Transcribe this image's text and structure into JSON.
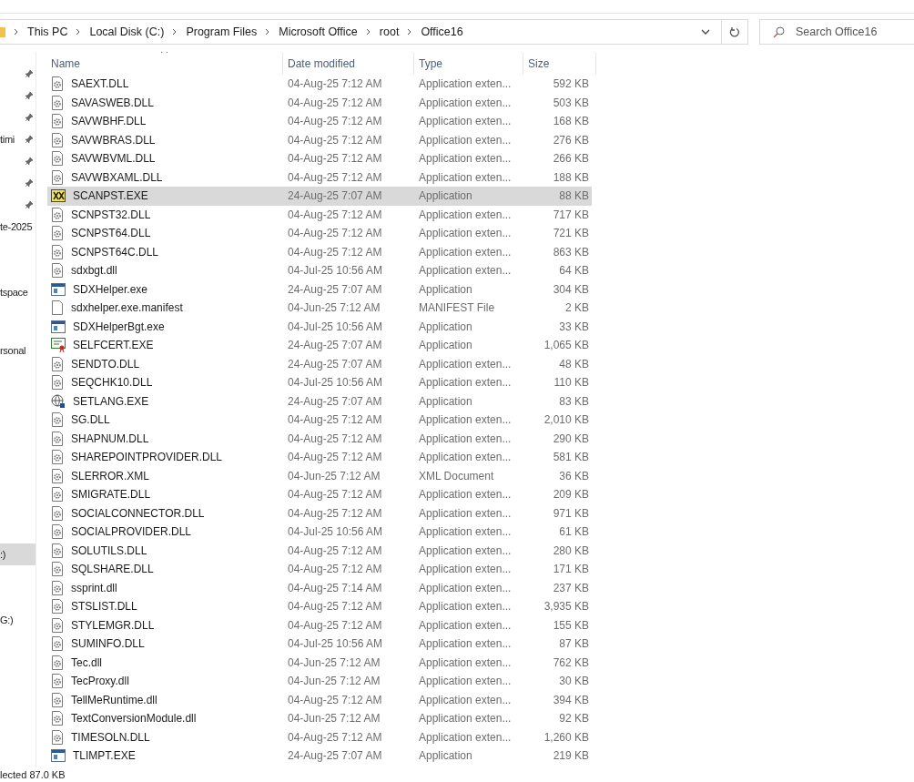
{
  "breadcrumb": [
    "This PC",
    "Local Disk (C:)",
    "Program Files",
    "Microsoft Office",
    "root",
    "Office16"
  ],
  "search": {
    "placeholder": "Search Office16"
  },
  "sidebar": {
    "items": [
      {
        "pinned": true
      },
      {
        "pinned": true
      },
      {
        "pinned": true
      },
      {
        "label": "timi",
        "pinned": true
      },
      {
        "pinned": true
      },
      {
        "pinned": true
      },
      {
        "pinned": true
      },
      {
        "label": "te-2025",
        "pinned": false,
        "selected": false
      },
      {
        "label": "tspace",
        "pinned": false,
        "selected": false
      },
      {
        "label": "rsonal",
        "pinned": false,
        "selected": false
      },
      {
        "label": ":)",
        "pinned": false,
        "selected": true
      },
      {
        "label": "G:)",
        "pinned": false,
        "selected": false
      }
    ]
  },
  "table": {
    "columns": [
      "Name",
      "Date modified",
      "Type",
      "Size"
    ],
    "rows": [
      {
        "kind": "dll",
        "name": "SAEXT.DLL",
        "date": "04-Aug-25 7:12 AM",
        "type": "Application exten...",
        "size": "592 KB",
        "selected": false
      },
      {
        "kind": "dll",
        "name": "SAVASWEB.DLL",
        "date": "04-Aug-25 7:12 AM",
        "type": "Application exten...",
        "size": "503 KB",
        "selected": false
      },
      {
        "kind": "dll",
        "name": "SAVWBHF.DLL",
        "date": "04-Aug-25 7:12 AM",
        "type": "Application exten...",
        "size": "168 KB",
        "selected": false
      },
      {
        "kind": "dll",
        "name": "SAVWBRAS.DLL",
        "date": "04-Aug-25 7:12 AM",
        "type": "Application exten...",
        "size": "276 KB",
        "selected": false
      },
      {
        "kind": "dll",
        "name": "SAVWBVML.DLL",
        "date": "04-Aug-25 7:12 AM",
        "type": "Application exten...",
        "size": "266 KB",
        "selected": false
      },
      {
        "kind": "dll",
        "name": "SAVWBXAML.DLL",
        "date": "04-Aug-25 7:12 AM",
        "type": "Application exten...",
        "size": "188 KB",
        "selected": false
      },
      {
        "kind": "repair",
        "name": "SCANPST.EXE",
        "date": "24-Aug-25 7:07 AM",
        "type": "Application",
        "size": "88 KB",
        "selected": true
      },
      {
        "kind": "dll",
        "name": "SCNPST32.DLL",
        "date": "04-Aug-25 7:12 AM",
        "type": "Application exten...",
        "size": "717 KB",
        "selected": false
      },
      {
        "kind": "dll",
        "name": "SCNPST64.DLL",
        "date": "04-Aug-25 7:12 AM",
        "type": "Application exten...",
        "size": "721 KB",
        "selected": false
      },
      {
        "kind": "dll",
        "name": "SCNPST64C.DLL",
        "date": "04-Aug-25 7:12 AM",
        "type": "Application exten...",
        "size": "863 KB",
        "selected": false
      },
      {
        "kind": "dll",
        "name": "sdxbgt.dll",
        "date": "04-Jul-25 10:56 AM",
        "type": "Application exten...",
        "size": "64 KB",
        "selected": false
      },
      {
        "kind": "app",
        "name": "SDXHelper.exe",
        "date": "24-Aug-25 7:07 AM",
        "type": "Application",
        "size": "304 KB",
        "selected": false
      },
      {
        "kind": "file",
        "name": "sdxhelper.exe.manifest",
        "date": "04-Jun-25 7:12 AM",
        "type": "MANIFEST File",
        "size": "2 KB",
        "selected": false
      },
      {
        "kind": "app",
        "name": "SDXHelperBgt.exe",
        "date": "04-Jul-25 10:56 AM",
        "type": "Application",
        "size": "33 KB",
        "selected": false
      },
      {
        "kind": "cert",
        "name": "SELFCERT.EXE",
        "date": "24-Aug-25 7:07 AM",
        "type": "Application",
        "size": "1,065 KB",
        "selected": false
      },
      {
        "kind": "dll",
        "name": "SENDTO.DLL",
        "date": "24-Aug-25 7:07 AM",
        "type": "Application exten...",
        "size": "48 KB",
        "selected": false
      },
      {
        "kind": "dll",
        "name": "SEQCHK10.DLL",
        "date": "04-Jul-25 10:56 AM",
        "type": "Application exten...",
        "size": "110 KB",
        "selected": false
      },
      {
        "kind": "globe",
        "name": "SETLANG.EXE",
        "date": "24-Aug-25 7:07 AM",
        "type": "Application",
        "size": "83 KB",
        "selected": false
      },
      {
        "kind": "dll",
        "name": "SG.DLL",
        "date": "04-Aug-25 7:12 AM",
        "type": "Application exten...",
        "size": "2,010 KB",
        "selected": false
      },
      {
        "kind": "dll",
        "name": "SHAPNUM.DLL",
        "date": "04-Aug-25 7:12 AM",
        "type": "Application exten...",
        "size": "290 KB",
        "selected": false
      },
      {
        "kind": "dll",
        "name": "SHAREPOINTPROVIDER.DLL",
        "date": "04-Aug-25 7:12 AM",
        "type": "Application exten...",
        "size": "581 KB",
        "selected": false
      },
      {
        "kind": "dll",
        "name": "SLERROR.XML",
        "date": "04-Jun-25 7:12 AM",
        "type": "XML Document",
        "size": "36 KB",
        "selected": false
      },
      {
        "kind": "dll",
        "name": "SMIGRATE.DLL",
        "date": "04-Aug-25 7:12 AM",
        "type": "Application exten...",
        "size": "209 KB",
        "selected": false
      },
      {
        "kind": "dll",
        "name": "SOCIALCONNECTOR.DLL",
        "date": "04-Aug-25 7:12 AM",
        "type": "Application exten...",
        "size": "971 KB",
        "selected": false
      },
      {
        "kind": "dll",
        "name": "SOCIALPROVIDER.DLL",
        "date": "04-Jul-25 10:56 AM",
        "type": "Application exten...",
        "size": "61 KB",
        "selected": false
      },
      {
        "kind": "dll",
        "name": "SOLUTILS.DLL",
        "date": "04-Aug-25 7:12 AM",
        "type": "Application exten...",
        "size": "280 KB",
        "selected": false
      },
      {
        "kind": "dll",
        "name": "SQLSHARE.DLL",
        "date": "04-Aug-25 7:12 AM",
        "type": "Application exten...",
        "size": "171 KB",
        "selected": false
      },
      {
        "kind": "dll",
        "name": "ssprint.dll",
        "date": "04-Aug-25 7:14 AM",
        "type": "Application exten...",
        "size": "237 KB",
        "selected": false
      },
      {
        "kind": "dll",
        "name": "STSLIST.DLL",
        "date": "04-Aug-25 7:12 AM",
        "type": "Application exten...",
        "size": "3,935 KB",
        "selected": false
      },
      {
        "kind": "dll",
        "name": "STYLEMGR.DLL",
        "date": "04-Aug-25 7:12 AM",
        "type": "Application exten...",
        "size": "155 KB",
        "selected": false
      },
      {
        "kind": "dll",
        "name": "SUMINFO.DLL",
        "date": "04-Jul-25 10:56 AM",
        "type": "Application exten...",
        "size": "87 KB",
        "selected": false
      },
      {
        "kind": "dll",
        "name": "Tec.dll",
        "date": "04-Jun-25 7:12 AM",
        "type": "Application exten...",
        "size": "762 KB",
        "selected": false
      },
      {
        "kind": "dll",
        "name": "TecProxy.dll",
        "date": "04-Jun-25 7:12 AM",
        "type": "Application exten...",
        "size": "30 KB",
        "selected": false
      },
      {
        "kind": "dll",
        "name": "TellMeRuntime.dll",
        "date": "04-Aug-25 7:12 AM",
        "type": "Application exten...",
        "size": "394 KB",
        "selected": false
      },
      {
        "kind": "dll",
        "name": "TextConversionModule.dll",
        "date": "04-Jun-25 7:12 AM",
        "type": "Application exten...",
        "size": "92 KB",
        "selected": false
      },
      {
        "kind": "dll",
        "name": "TIMESOLN.DLL",
        "date": "04-Aug-25 7:12 AM",
        "type": "Application exten...",
        "size": "1,260 KB",
        "selected": false
      },
      {
        "kind": "app",
        "name": "TLIMPT.EXE",
        "date": "24-Aug-25 7:07 AM",
        "type": "Application",
        "size": "219 KB",
        "selected": false
      }
    ]
  },
  "status_bar": {
    "text": "lected 87.0 KB"
  }
}
